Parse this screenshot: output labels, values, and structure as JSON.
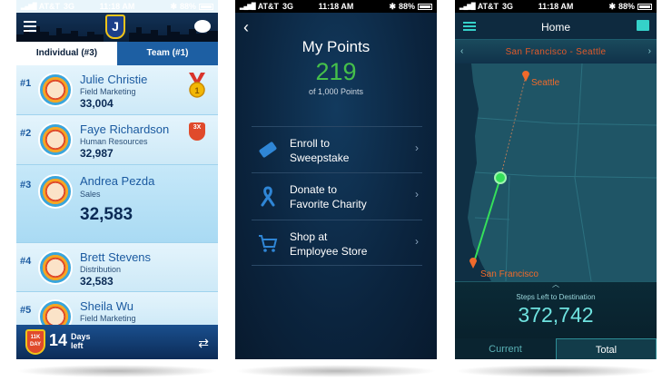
{
  "status_bars": [
    {
      "carrier": "AT&T",
      "network": "3G",
      "time": "11:18 AM",
      "battery": "88%"
    },
    {
      "carrier": "AT&T",
      "network": "3G",
      "time": "11:18 AM",
      "battery": "88%"
    },
    {
      "carrier": "AT&T",
      "network": "3G",
      "time": "11:18 AM",
      "battery": "88%"
    }
  ],
  "leaderboard": {
    "logo_letter": "J",
    "tabs": [
      {
        "label": "Individual (#3)",
        "active": true
      },
      {
        "label": "Team (#1)",
        "active": false
      }
    ],
    "entries": [
      {
        "rank": "#1",
        "name": "Julie Christie",
        "department": "Field Marketing",
        "score": "33,004",
        "award": "gold-medal-icon"
      },
      {
        "rank": "#2",
        "name": "Faye Richardson",
        "department": "Human Resources",
        "score": "32,987",
        "award": "3x-badge-icon",
        "award_text": "3X"
      },
      {
        "rank": "#3",
        "name": "Andrea Pezda",
        "department": "Sales",
        "score": "32,583",
        "highlighted": true
      },
      {
        "rank": "#4",
        "name": "Brett Stevens",
        "department": "Distribution",
        "score": "32,583"
      },
      {
        "rank": "#5",
        "name": "Sheila Wu",
        "department": "Field Marketing",
        "score": ""
      }
    ],
    "footer": {
      "badge_text": "11K DAY",
      "days_value": "14",
      "days_label_1": "Days",
      "days_label_2": "left"
    }
  },
  "points": {
    "title": "My Points",
    "value": "219",
    "subtitle": "of 1,000 Points",
    "menu": [
      {
        "line1": "Enroll to",
        "line2": "Sweepstake",
        "icon": "ticket-icon"
      },
      {
        "line1": "Donate to",
        "line2": "Favorite Charity",
        "icon": "ribbon-icon"
      },
      {
        "line1": "Shop at",
        "line2": "Employee Store",
        "icon": "shopping-cart-icon"
      }
    ]
  },
  "journey": {
    "title": "Home",
    "route": "San Francisco - Seattle",
    "map_labels": {
      "start": "San Francisco",
      "end": "Seattle"
    },
    "steps_label": "Steps Left to Destination",
    "steps_value": "372,742",
    "segments": [
      {
        "label": "Current",
        "active": false
      },
      {
        "label": "Total",
        "active": true
      }
    ]
  },
  "colors": {
    "leaderboard_blue": "#1b5aa0",
    "points_green": "#45c04a",
    "journey_teal": "#6fe3e0",
    "route_orange": "#e05a2b"
  }
}
